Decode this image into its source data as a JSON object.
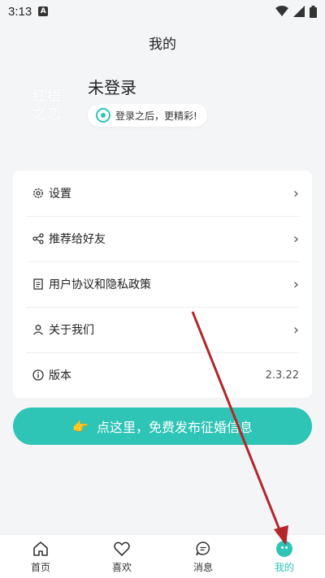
{
  "status_bar": {
    "time": "3:13",
    "notification": "A"
  },
  "header": {
    "title": "我的"
  },
  "profile": {
    "avatar_line1": "红梧",
    "avatar_line2": "之恋",
    "username": "未登录",
    "login_hint": "登录之后，更精彩!"
  },
  "menu": {
    "items": [
      {
        "label": "设置",
        "icon": "gear-icon"
      },
      {
        "label": "推荐给好友",
        "icon": "share-icon"
      },
      {
        "label": "用户协议和隐私政策",
        "icon": "document-icon"
      },
      {
        "label": "关于我们",
        "icon": "user-icon"
      },
      {
        "label": "版本",
        "icon": "info-icon",
        "value": "2.3.22"
      }
    ]
  },
  "cta": {
    "label": "点这里，免费发布征婚信息",
    "icon": "pointing-hand-icon"
  },
  "bottom_nav": {
    "items": [
      {
        "label": "首页",
        "icon": "home-icon"
      },
      {
        "label": "喜欢",
        "icon": "heart-icon"
      },
      {
        "label": "消息",
        "icon": "message-icon"
      },
      {
        "label": "我的",
        "icon": "me-icon",
        "active": true
      }
    ]
  },
  "colors": {
    "accent": "#2ec4b6",
    "background": "#f4f5f7",
    "annotation_arrow": "#b3262a"
  }
}
